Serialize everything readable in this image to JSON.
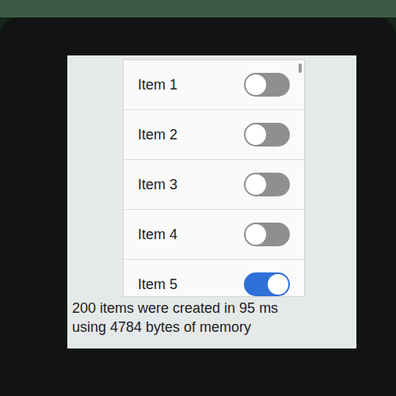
{
  "list": {
    "items": [
      {
        "label": "Item 1",
        "on": false
      },
      {
        "label": "Item 2",
        "on": false
      },
      {
        "label": "Item 3",
        "on": false
      },
      {
        "label": "Item 4",
        "on": false
      },
      {
        "label": "Item 5",
        "on": true
      }
    ]
  },
  "status": {
    "lines": [
      "200 items were created in 95 ms",
      "using 4784 bytes of memory"
    ]
  }
}
